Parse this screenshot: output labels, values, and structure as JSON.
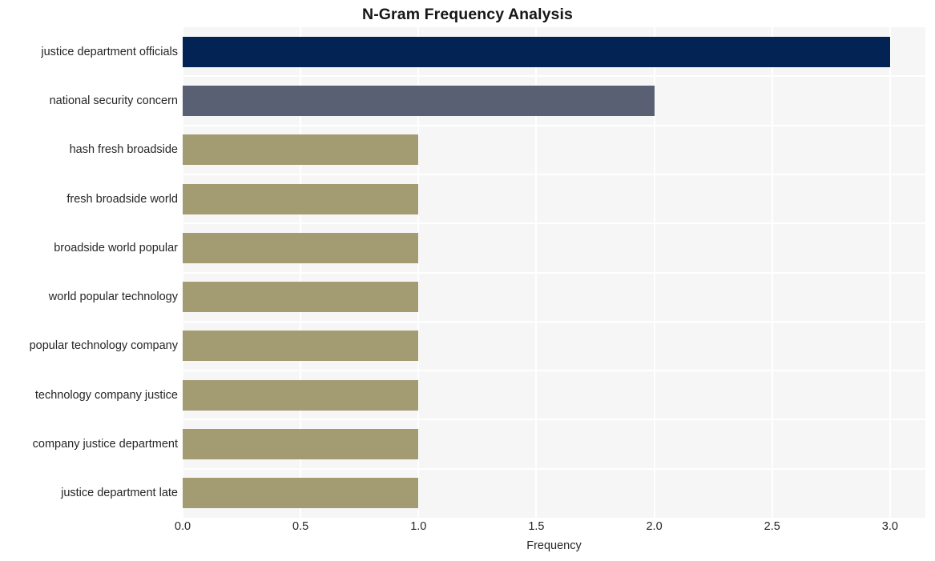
{
  "chart_data": {
    "type": "bar",
    "orientation": "horizontal",
    "title": "N-Gram Frequency Analysis",
    "xlabel": "Frequency",
    "ylabel": "",
    "categories": [
      "justice department officials",
      "national security concern",
      "hash fresh broadside",
      "fresh broadside world",
      "broadside world popular",
      "world popular technology",
      "popular technology company",
      "technology company justice",
      "company justice department",
      "justice department late"
    ],
    "values": [
      3,
      2,
      1,
      1,
      1,
      1,
      1,
      1,
      1,
      1
    ],
    "bar_colors": [
      "#032354",
      "#5a6073",
      "#a39b72",
      "#a39b72",
      "#a39b72",
      "#a39b72",
      "#a39b72",
      "#a39b72",
      "#a39b72",
      "#a39b72"
    ],
    "xlim": [
      0,
      3.15
    ],
    "xticks": [
      0,
      0.5,
      1,
      1.5,
      2,
      2.5,
      3
    ],
    "xtick_labels": [
      "0.0",
      "0.5",
      "1.0",
      "1.5",
      "2.0",
      "2.5",
      "3.0"
    ],
    "grid": true,
    "grid_color": "#ffffff",
    "plot_background": "#f6f6f7",
    "figure_background": "#ffffff",
    "legend": null,
    "legend_position": "none"
  }
}
